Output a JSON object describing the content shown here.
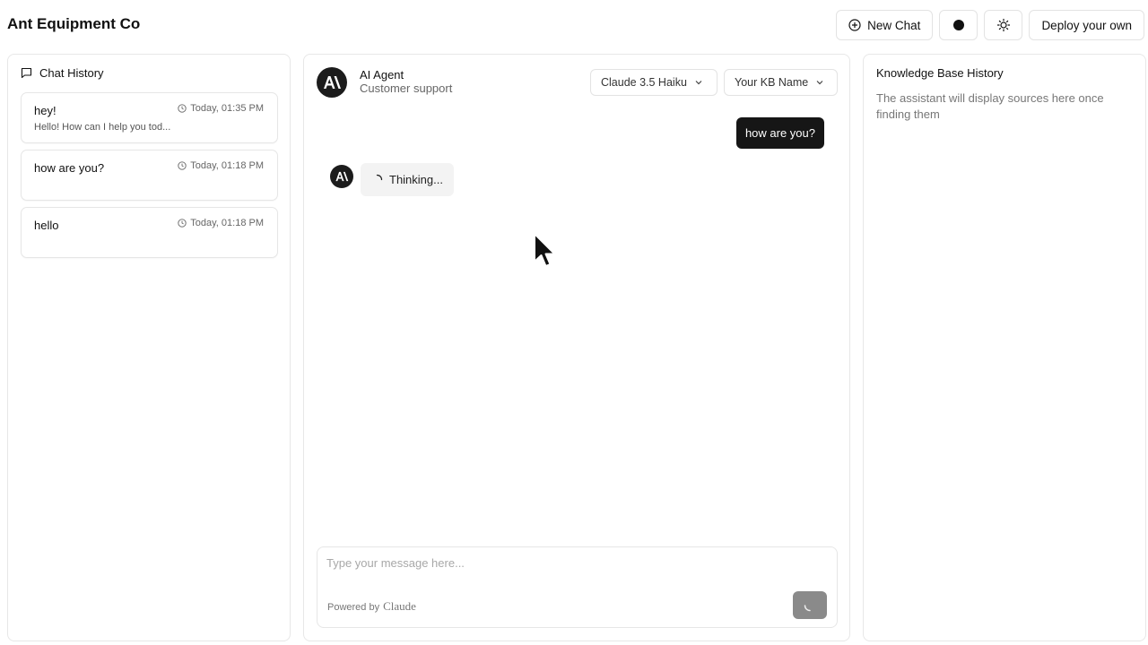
{
  "app": {
    "title": "Ant Equipment Co"
  },
  "header": {
    "new_chat_label": "New Chat",
    "deploy_label": "Deploy your own"
  },
  "chat_history": {
    "title": "Chat History",
    "items": [
      {
        "title": "hey!",
        "time": "Today, 01:35 PM",
        "preview": "Hello! How can I help you tod..."
      },
      {
        "title": "how are you?",
        "time": "Today, 01:18 PM",
        "preview": ""
      },
      {
        "title": "hello",
        "time": "Today, 01:18 PM",
        "preview": ""
      }
    ]
  },
  "agent": {
    "name": "AI Agent",
    "subtitle": "Customer support",
    "model_selected": "Claude 3.5 Haiku",
    "kb_selected": "Your KB Name"
  },
  "conversation": {
    "user_message": "how are you?",
    "assistant_status": "Thinking..."
  },
  "composer": {
    "placeholder": "Type your message here...",
    "powered_prefix": "Powered by",
    "powered_brand": "Claude"
  },
  "knowledge_base": {
    "title": "Knowledge Base History",
    "empty_text": "The assistant will display sources here once finding them"
  },
  "icons": {
    "new_chat": "plus-circle-icon",
    "theme_dot": "circle-icon",
    "theme_toggle": "sun-icon",
    "history": "message-square-icon",
    "time": "clock-icon",
    "dropdown": "chevron-down-icon",
    "loading": "spinner-icon"
  },
  "colors": {
    "dark": "#161616",
    "border": "#e6e6e6",
    "muted_text": "#777777",
    "send_button": "#8a8a8a",
    "thinking_bg": "#f3f3f3"
  }
}
